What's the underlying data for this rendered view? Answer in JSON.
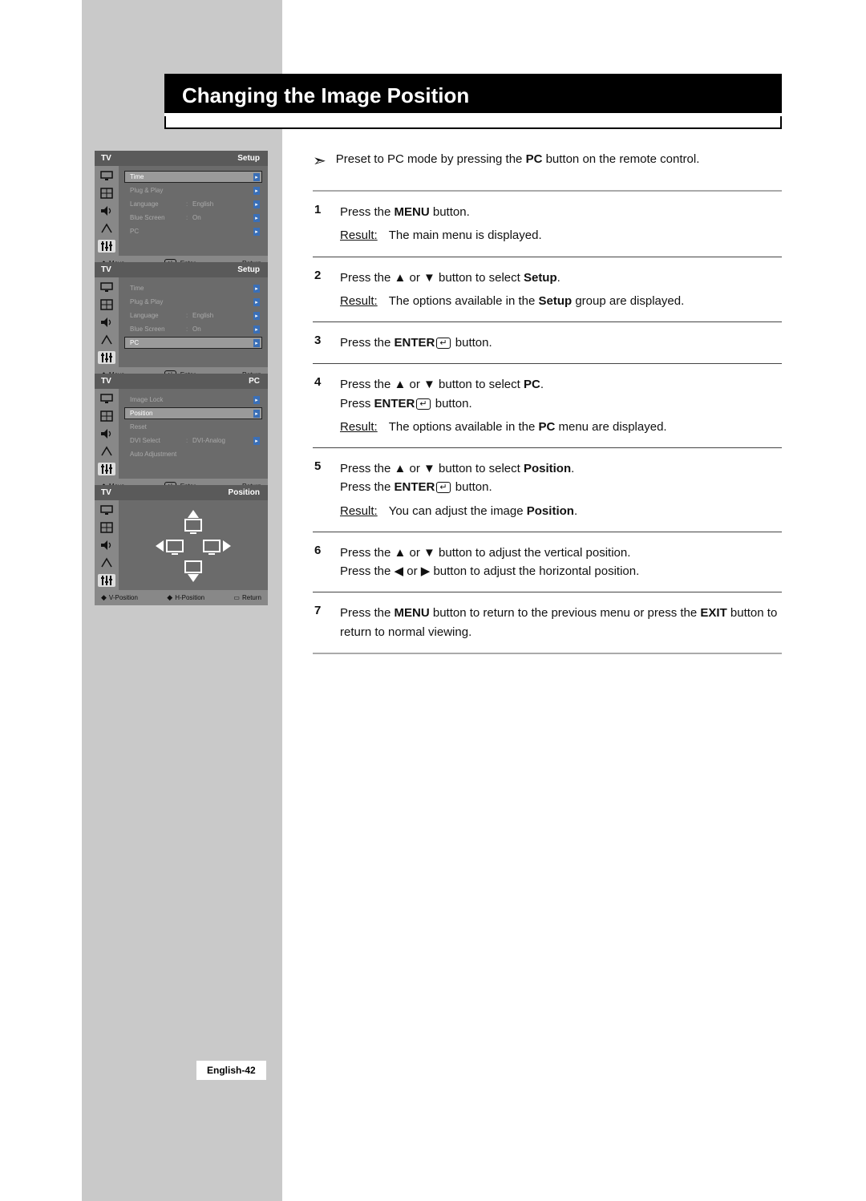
{
  "title": "Changing the Image Position",
  "note_text_pre": "Preset to PC mode by pressing the ",
  "note_text_bold": "PC",
  "note_text_post": " button on the remote control.",
  "osd": {
    "tv_label": "TV",
    "title_setup": "Setup",
    "title_pc": "PC",
    "title_position": "Position",
    "footer_move": "Move",
    "footer_enter": "Enter",
    "footer_return": "Return",
    "footer_vpos": "V-Position",
    "footer_hpos": "H-Position",
    "setup_items": [
      {
        "label": "Time",
        "sep": "",
        "val": ""
      },
      {
        "label": "Plug & Play",
        "sep": "",
        "val": ""
      },
      {
        "label": "Language",
        "sep": ":",
        "val": "English"
      },
      {
        "label": "Blue Screen",
        "sep": ":",
        "val": "On"
      },
      {
        "label": "PC",
        "sep": "",
        "val": ""
      }
    ],
    "pc_items": [
      {
        "label": "Image Lock",
        "sep": "",
        "val": ""
      },
      {
        "label": "Position",
        "sep": "",
        "val": ""
      },
      {
        "label": "Reset",
        "sep": "",
        "val": ""
      },
      {
        "label": "DVI Select",
        "sep": ":",
        "val": "DVI-Analog"
      },
      {
        "label": "Auto Adjustment",
        "sep": "",
        "val": ""
      }
    ]
  },
  "steps": {
    "s1": {
      "num": "1",
      "l1_pre": "Press the ",
      "l1_b": "MENU",
      "l1_post": " button.",
      "res": "The main menu is displayed."
    },
    "s2": {
      "num": "2",
      "l1_pre": "Press the ▲ or ▼ button to select ",
      "l1_b": "Setup",
      "l1_post": ".",
      "res_pre": "The options available in the ",
      "res_b": "Setup",
      "res_post": " group are displayed."
    },
    "s3": {
      "num": "3",
      "l1_pre": "Press the ",
      "l1_b": "ENTER",
      "l1_post": " button."
    },
    "s4": {
      "num": "4",
      "l1_pre": "Press the ▲ or ▼ button to select ",
      "l1_b": "PC",
      "l1_post": ".",
      "l2_pre": "Press ",
      "l2_b": "ENTER",
      "l2_post": " button.",
      "res_pre": "The options available in the ",
      "res_b": "PC",
      "res_post": " menu are displayed."
    },
    "s5": {
      "num": "5",
      "l1_pre": "Press the ▲ or ▼ button to select ",
      "l1_b": "Position",
      "l1_post": ".",
      "l2_pre": "Press the ",
      "l2_b": "ENTER",
      "l2_post": " button.",
      "res_pre": "You can adjust the image ",
      "res_b": "Position",
      "res_post": "."
    },
    "s6": {
      "num": "6",
      "l1": "Press the ▲ or ▼ button to adjust the vertical position.",
      "l2": "Press the ◀ or ▶ button to adjust the horizontal position."
    },
    "s7": {
      "num": "7",
      "l1_pre": "Press the ",
      "l1_b": "MENU",
      "l1_mid": " button to return to the previous menu or press the ",
      "l1_b2": "EXIT",
      "l1_post": " button to return to normal viewing."
    }
  },
  "result_label": "Result:",
  "page_num": "English-42"
}
